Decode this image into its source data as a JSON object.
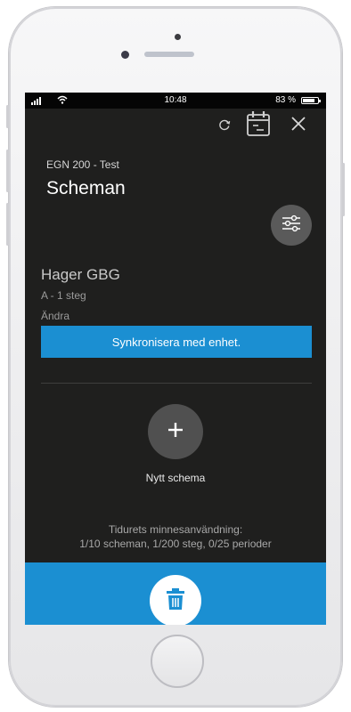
{
  "status_bar": {
    "time": "10:48",
    "battery": "83 %",
    "battery_level": 0.83
  },
  "header": {
    "subtitle": "EGN 200 - Test",
    "title": "Scheman"
  },
  "schedule": {
    "name": "Hager GBG",
    "steps": "A  -  1 steg",
    "edit_label": "Ändra",
    "sync_label": "Synkronisera med enhet."
  },
  "add": {
    "label": "Nytt schema"
  },
  "memory": {
    "title": "Tidurets minnesanvändning:",
    "detail": "1/10 scheman, 1/200 steg, 0/25 perioder"
  },
  "icons": {
    "sync": "sync-icon",
    "calendar": "calendar-icon",
    "close": "close-icon",
    "filter": "sliders-icon",
    "add": "plus-icon",
    "delete": "trash-icon"
  },
  "colors": {
    "accent": "#1b8fd2",
    "background": "#1f1f1e",
    "button_gray": "#5a5a5a"
  }
}
